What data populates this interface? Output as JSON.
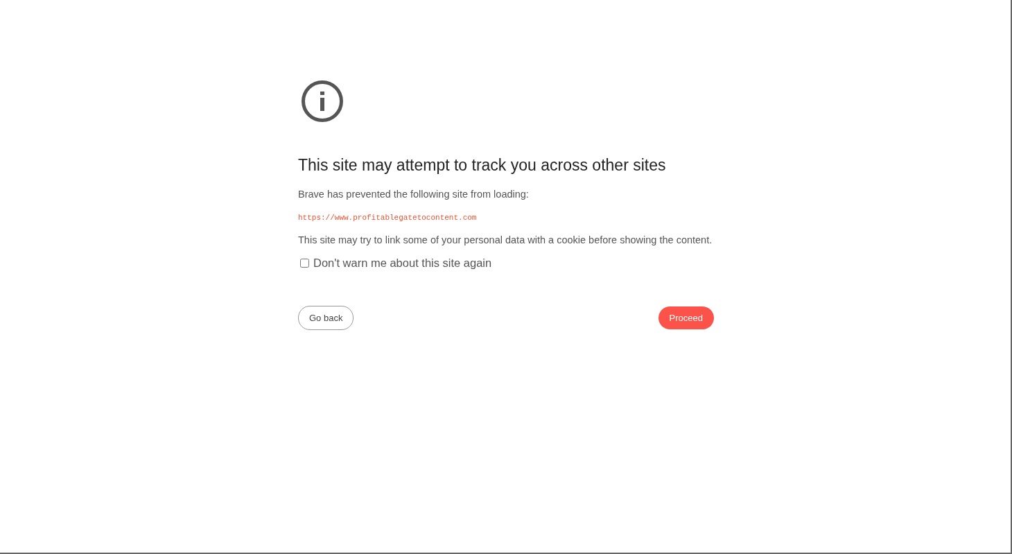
{
  "title": "This site may attempt to track you across other sites",
  "intro": "Brave has prevented the following site from loading:",
  "url": "https://www.profitablegatetocontent.com",
  "explanation": "This site may try to link some of your personal data with a cookie before showing the content.",
  "dont_warn": {
    "label": "Don't warn me about this site again",
    "checked": false
  },
  "buttons": [
    {
      "kind": "secondary",
      "label": "Go back"
    },
    {
      "kind": "primary",
      "label": "Proceed"
    }
  ]
}
